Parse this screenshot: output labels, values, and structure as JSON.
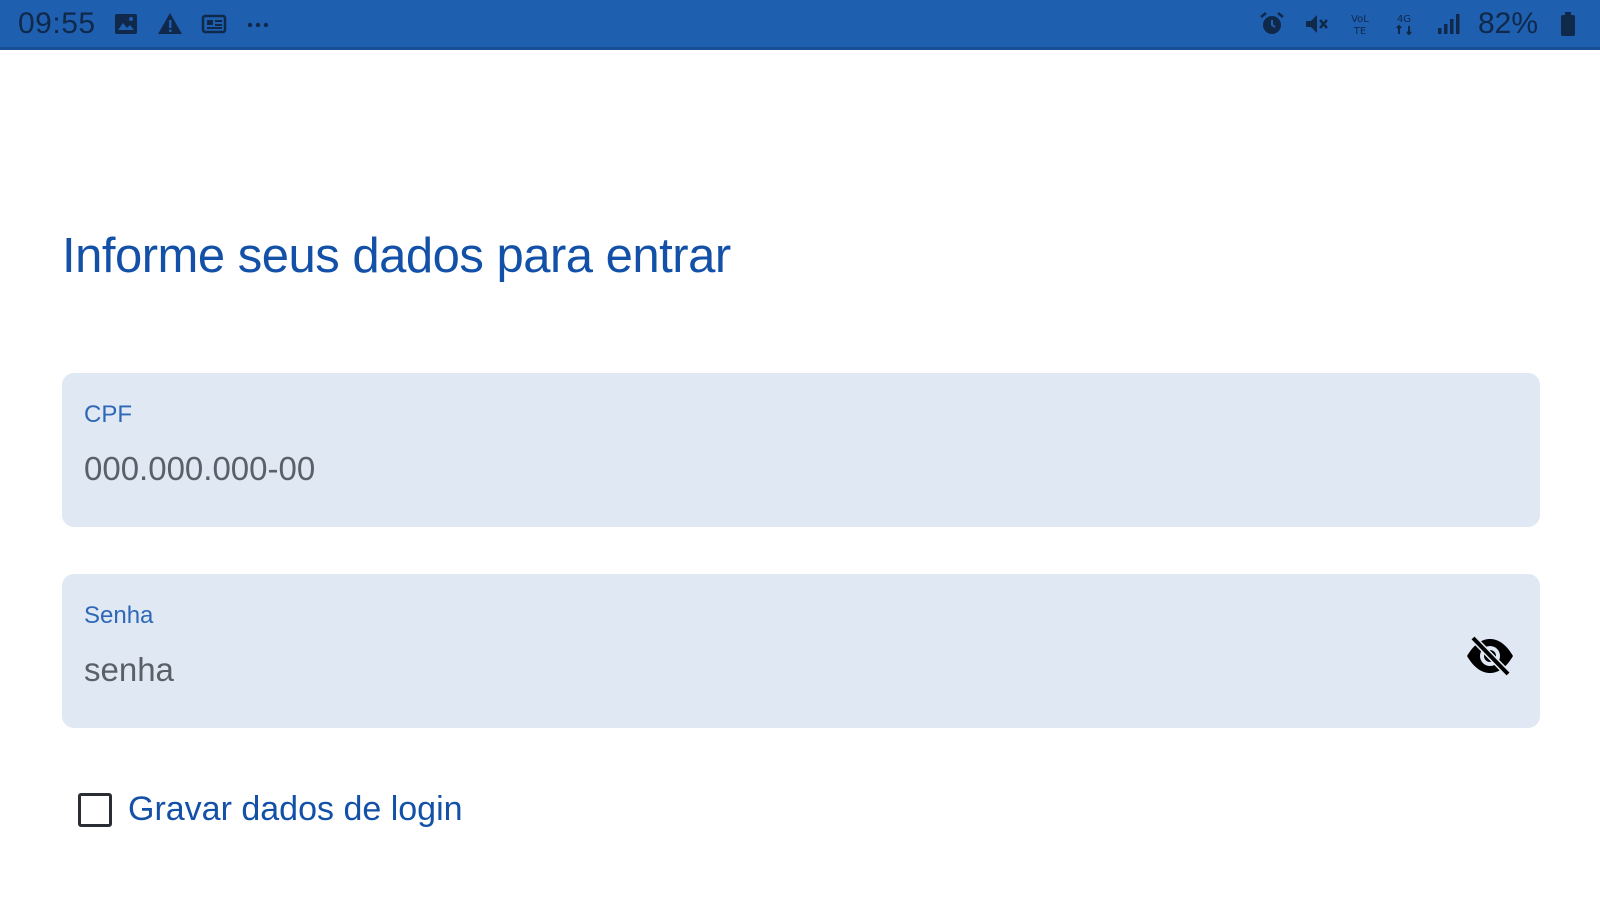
{
  "status_bar": {
    "time": "09:55",
    "battery": "82%",
    "left_icons": [
      "image-icon",
      "warning-icon",
      "news-icon",
      "more-dots-icon"
    ],
    "right_icons": [
      "alarm-icon",
      "mute-icon",
      "volte-icon",
      "4g-icon",
      "signal-icon",
      "battery-icon"
    ]
  },
  "page": {
    "title": "Informe seus dados para entrar"
  },
  "form": {
    "cpf": {
      "label": "CPF",
      "placeholder": "000.000.000-00"
    },
    "password": {
      "label": "Senha",
      "placeholder": "senha",
      "visibility_icon": "eye-off-icon"
    },
    "remember": {
      "label": "Gravar dados de login",
      "checked": false
    }
  },
  "colors": {
    "status_bar": "#1f5fb0",
    "accent": "#1351a8",
    "field_background": "#e0e8f3"
  }
}
